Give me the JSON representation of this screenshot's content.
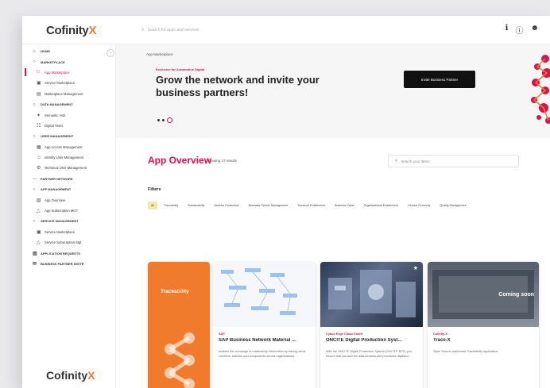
{
  "app": {
    "logo_text": "Cofinity",
    "logo_x": "X",
    "search_placeholder": "Search for apps and services"
  },
  "top_icons": [
    "translate-icon",
    "help-icon",
    "user-icon"
  ],
  "sidebar": {
    "items": [
      {
        "label": "HOME",
        "type": "section",
        "icon": "home-icon"
      },
      {
        "label": "MARKETPLACE",
        "type": "section",
        "icon": "circle-icon"
      },
      {
        "label": "App Marketplace",
        "type": "item",
        "icon": "app-icon",
        "active": true
      },
      {
        "label": "Service Marketplace",
        "type": "item",
        "icon": "service-icon"
      },
      {
        "label": "Marketplace Management",
        "type": "item",
        "icon": "management-icon"
      },
      {
        "label": "DATA MANAGEMENT",
        "type": "section",
        "icon": "circle-icon"
      },
      {
        "label": "Semantic Hub",
        "type": "item",
        "icon": "hub-icon"
      },
      {
        "label": "Digital Twins",
        "type": "item",
        "icon": "twin-icon"
      },
      {
        "label": "USER MANAGEMENT",
        "type": "section",
        "icon": "circle-icon"
      },
      {
        "label": "App Access Management",
        "type": "item",
        "icon": "access-icon"
      },
      {
        "label": "Identity User Management",
        "type": "item",
        "icon": "identity-icon"
      },
      {
        "label": "Technical User Management",
        "type": "item",
        "icon": "technical-user-icon"
      },
      {
        "label": "PARTNER NETWORK",
        "type": "section",
        "icon": "network-icon"
      },
      {
        "label": "APP MANAGEMENT",
        "type": "section",
        "icon": "circle-icon"
      },
      {
        "label": "App Overview",
        "type": "item",
        "icon": "overview-icon"
      },
      {
        "label": "App Subscription MGT",
        "type": "item",
        "icon": "subscription-icon"
      },
      {
        "label": "SERVICE MANAGEMENT",
        "type": "section",
        "icon": "circle-icon"
      },
      {
        "label": "Service Marketplace",
        "type": "item",
        "icon": "service-icon"
      },
      {
        "label": "Service Subscription Mgt",
        "type": "item",
        "icon": "subscription-icon"
      },
      {
        "label": "APPLICATION REQUESTS",
        "type": "section",
        "icon": "request-icon"
      },
      {
        "label": "BUSINESS PARTNER INVITE",
        "type": "section",
        "icon": "invite-icon"
      }
    ],
    "footer_logo": "Cofinity",
    "footer_x": "X"
  },
  "hero": {
    "breadcrumb": "App Marketplace",
    "eyebrow": "Exclusive for Automotive Digital",
    "headline": "Grow the network and invite your business partners!",
    "invite_button": "Invite Business Partner"
  },
  "overview": {
    "title": "App Overview",
    "count": "Showing 17 results",
    "search_placeholder": "Search your items",
    "filters_label": "Filters",
    "chips": [
      {
        "label": "All",
        "active": true
      },
      {
        "label": "Traceability"
      },
      {
        "label": "Sustainability"
      },
      {
        "label": "Modular Production"
      },
      {
        "label": "Business Partner Management"
      },
      {
        "label": "Technical Enablement"
      },
      {
        "label": "Business Value"
      },
      {
        "label": "Organizational Enablement"
      },
      {
        "label": "Circular Economy"
      },
      {
        "label": "Quality Management"
      }
    ]
  },
  "cards": [
    {
      "tag": "Traceability"
    },
    {
      "vendor": "SAP",
      "name": "SAP Business Network Material ...",
      "desc": "enables the exchange of relationship information by tracing serial numbers, batches and components across organizations."
    },
    {
      "vendor": "Cybus Edge Cloud GmbH",
      "name": "ONCITE Digital Production Syst...",
      "desc": "With the ONCITE Digital Production System (ONCITE DPS) you ensure that you add the data streams and processes digitized."
    },
    {
      "vendor": "Cofinity-X",
      "name": "Trace-X",
      "desc": "Open Source dashboard Traceability application.",
      "overlay": "Coming soon"
    }
  ]
}
